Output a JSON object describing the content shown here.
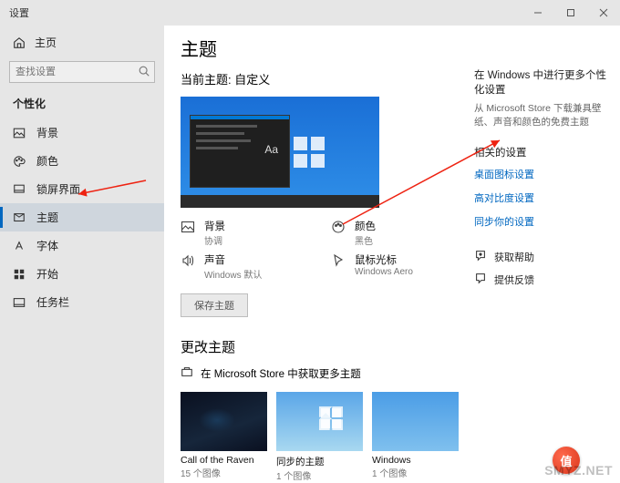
{
  "titlebar": {
    "title": "设置"
  },
  "sidebar": {
    "home": "主页",
    "search_placeholder": "查找设置",
    "section": "个性化",
    "items": [
      {
        "label": "背景"
      },
      {
        "label": "颜色"
      },
      {
        "label": "锁屏界面"
      },
      {
        "label": "主题"
      },
      {
        "label": "字体"
      },
      {
        "label": "开始"
      },
      {
        "label": "任务栏"
      }
    ]
  },
  "main": {
    "title": "主题",
    "current_label": "当前主题: 自定义",
    "preview_aa": "Aa",
    "settings": {
      "background": {
        "label": "背景",
        "value": "协调"
      },
      "color": {
        "label": "颜色",
        "value": "黑色"
      },
      "sound": {
        "label": "声音",
        "value": "Windows 默认"
      },
      "cursor": {
        "label": "鼠标光标",
        "value": "Windows Aero"
      }
    },
    "save_button": "保存主题",
    "change_heading": "更改主题",
    "store_line": "在 Microsoft Store 中获取更多主题",
    "themes": [
      {
        "name": "Call of the Raven",
        "meta": "15 个图像"
      },
      {
        "name": "同步的主题",
        "meta": "1 个图像"
      },
      {
        "name": "Windows",
        "meta": "1 个图像"
      }
    ]
  },
  "right": {
    "hint_title": "在 Windows 中进行更多个性化设置",
    "hint_body": "从 Microsoft Store 下载兼具壁纸、声音和颜色的免费主题",
    "related_title": "相关的设置",
    "links": [
      "桌面图标设置",
      "高对比度设置",
      "同步你的设置"
    ],
    "help": "获取帮助",
    "feedback": "提供反馈"
  },
  "watermark": "SMYZ.NET",
  "badge": "值"
}
